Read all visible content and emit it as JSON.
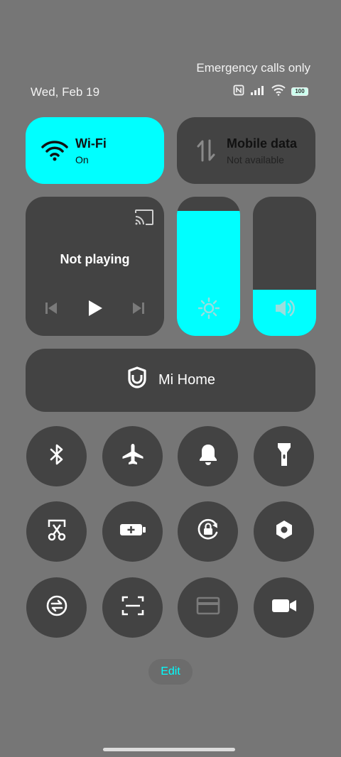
{
  "status_bar": {
    "carrier_text": "Emergency calls only",
    "date": "Wed, Feb 19",
    "battery": "100",
    "icons": [
      "nfc-icon",
      "signal-icon",
      "wifi-icon",
      "battery-icon"
    ]
  },
  "tiles": {
    "wifi": {
      "title": "Wi-Fi",
      "status": "On"
    },
    "mobile_data": {
      "title": "Mobile data",
      "status": "Not available"
    }
  },
  "media": {
    "status": "Not playing",
    "icons": [
      "cast-icon",
      "previous-icon",
      "play-icon",
      "next-icon"
    ]
  },
  "sliders": {
    "brightness_level": 0.9,
    "volume_level": 0.33
  },
  "mi_home": {
    "label": "Mi Home"
  },
  "toggles": [
    {
      "icon": "bluetooth-icon",
      "on": false
    },
    {
      "icon": "airplane-icon",
      "on": false
    },
    {
      "icon": "bell-icon",
      "on": false
    },
    {
      "icon": "flashlight-icon",
      "on": false
    },
    {
      "icon": "screenshot-icon",
      "on": false
    },
    {
      "icon": "battery-saver-icon",
      "on": false
    },
    {
      "icon": "rotation-lock-icon",
      "on": false
    },
    {
      "icon": "settings-hex-icon",
      "on": false
    },
    {
      "icon": "sync-icon",
      "on": false
    },
    {
      "icon": "scanner-icon",
      "on": false
    },
    {
      "icon": "card-icon",
      "on": false
    },
    {
      "icon": "video-camera-icon",
      "on": false
    }
  ],
  "edit": {
    "label": "Edit"
  },
  "colors": {
    "accent": "#00ffff",
    "tile": "#434343",
    "background": "#767676"
  }
}
